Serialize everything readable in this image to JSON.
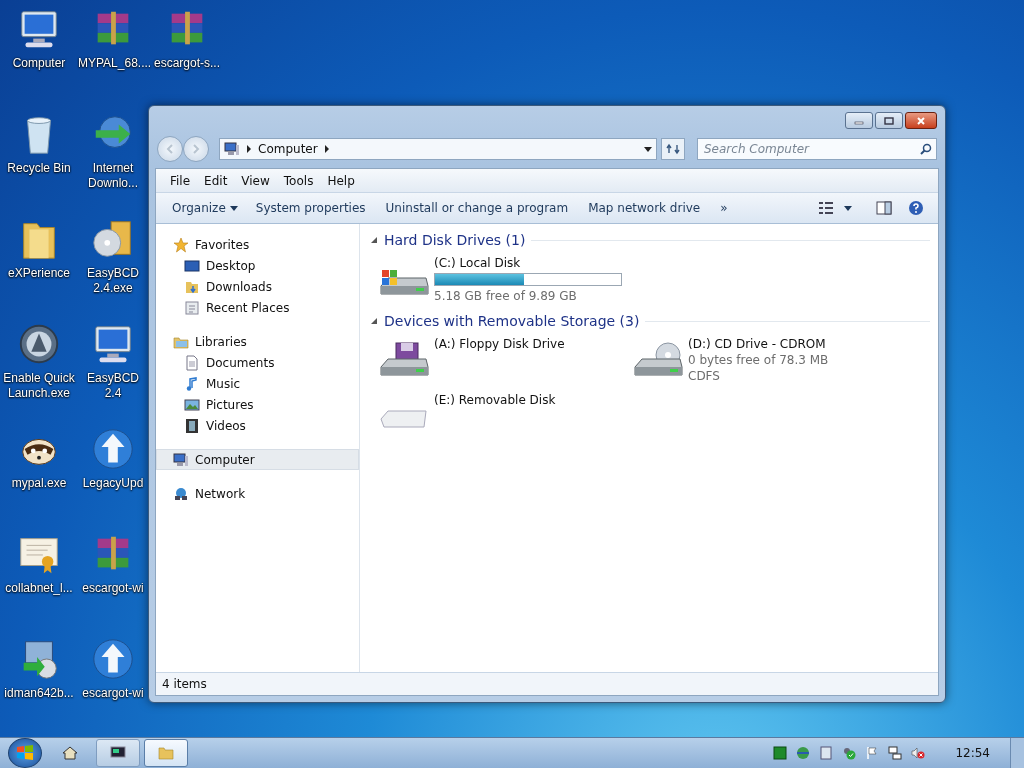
{
  "desktop": {
    "icons": [
      {
        "label": "Computer",
        "kind": "computer"
      },
      {
        "label": "Recycle Bin",
        "kind": "bin"
      },
      {
        "label": "eXPerience",
        "kind": "folder"
      },
      {
        "label": "Enable Quick Launch.exe",
        "kind": "app"
      },
      {
        "label": "mypal.exe",
        "kind": "raccoon"
      },
      {
        "label": "collabnet_l...",
        "kind": "certificate"
      },
      {
        "label": "idman642b...",
        "kind": "installer"
      },
      {
        "label": "MYPAL_68....",
        "kind": "archive"
      },
      {
        "label": "Internet Downlo...",
        "kind": "download"
      },
      {
        "label": "EasyBCD 2.4.exe",
        "kind": "disc"
      },
      {
        "label": "EasyBCD 2.4",
        "kind": "computer"
      },
      {
        "label": "LegacyUpd",
        "kind": "update"
      },
      {
        "label": "escargot-wi",
        "kind": "archive"
      },
      {
        "label": "escargot-wi",
        "kind": "update"
      },
      {
        "label": "escargot-s...",
        "kind": "archive"
      }
    ]
  },
  "window": {
    "address": {
      "path": [
        "Computer"
      ]
    },
    "search": {
      "placeholder": "Search Computer"
    },
    "menu": [
      "File",
      "Edit",
      "View",
      "Tools",
      "Help"
    ],
    "commands": [
      {
        "label": "Organize",
        "dropdown": true
      },
      {
        "label": "System properties",
        "dropdown": false
      },
      {
        "label": "Uninstall or change a program",
        "dropdown": false
      },
      {
        "label": "Map network drive",
        "dropdown": false
      }
    ],
    "more": "»",
    "nav": [
      {
        "label": "Favorites",
        "kind": "star",
        "selected": false,
        "children": [
          {
            "label": "Desktop",
            "kind": "desktop",
            "selected": false
          },
          {
            "label": "Downloads",
            "kind": "downloads",
            "selected": false
          },
          {
            "label": "Recent Places",
            "kind": "recent",
            "selected": false
          }
        ]
      },
      {
        "label": "Libraries",
        "kind": "libraries",
        "selected": false,
        "children": [
          {
            "label": "Documents",
            "kind": "documents",
            "selected": false
          },
          {
            "label": "Music",
            "kind": "music",
            "selected": false
          },
          {
            "label": "Pictures",
            "kind": "pictures",
            "selected": false
          },
          {
            "label": "Videos",
            "kind": "videos",
            "selected": false
          }
        ]
      },
      {
        "label": "Computer",
        "kind": "computer",
        "selected": true
      },
      {
        "label": "Network",
        "kind": "network",
        "selected": false
      }
    ],
    "groups": [
      {
        "title": "Hard Disk Drives (1)",
        "expanded": true,
        "items": [
          {
            "name": "(C:) Local Disk",
            "kind": "hdd",
            "level": 0.476,
            "details": [
              "5.18 GB free of 9.89 GB"
            ]
          }
        ]
      },
      {
        "title": "Devices with Removable Storage (3)",
        "expanded": true,
        "items": [
          {
            "name": "(A:) Floppy Disk Drive",
            "kind": "floppy"
          },
          {
            "name": "(D:) CD Drive - CDROM",
            "kind": "cd",
            "details": [
              "0 bytes free of 78.3 MB",
              "CDFS"
            ]
          },
          {
            "name": "(E:) Removable Disk",
            "kind": "removable"
          }
        ]
      }
    ],
    "status": "4 items"
  },
  "taskbar": {
    "buttons": [
      {
        "kind": "terminal",
        "selected": false
      },
      {
        "kind": "explorer",
        "selected": true
      }
    ],
    "clock": "12:54"
  }
}
